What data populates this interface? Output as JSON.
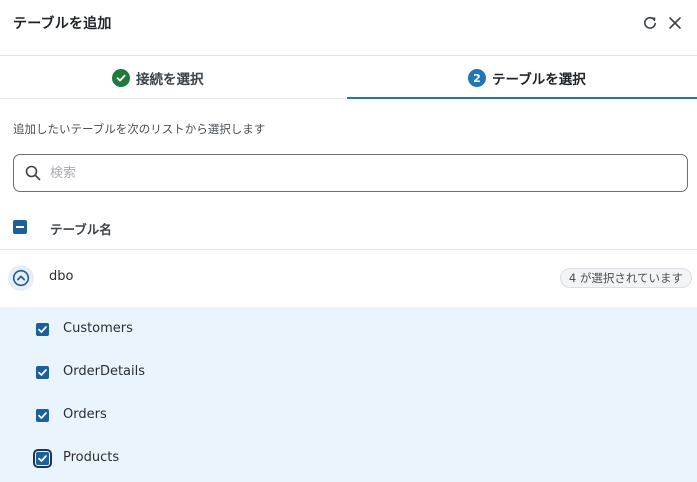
{
  "dialog": {
    "title": "テーブルを追加",
    "refresh_icon": "refresh-icon",
    "close_icon": "close-icon"
  },
  "steps": [
    {
      "label": "接続を選択",
      "status": "complete",
      "icon": "check-circle-icon"
    },
    {
      "number": "2",
      "label": "テーブルを選択",
      "status": "active"
    }
  ],
  "description": "追加したいテーブルを次のリストから選択します",
  "search": {
    "placeholder": "検索",
    "value": ""
  },
  "list_header": {
    "column_label": "テーブル名",
    "select_state": "indeterminate"
  },
  "group": {
    "name": "dbo",
    "expanded": true,
    "selected_badge": "4 が選択されています"
  },
  "tables": [
    {
      "name": "Customers",
      "checked": true
    },
    {
      "name": "OrderDetails",
      "checked": true
    },
    {
      "name": "Orders",
      "checked": true
    },
    {
      "name": "Products",
      "checked": true
    }
  ],
  "colors": {
    "accent": "#1f77b9",
    "checkbox": "#1d5e9c",
    "success": "#1e7a3d",
    "selected_bg": "#eaf4fc"
  }
}
